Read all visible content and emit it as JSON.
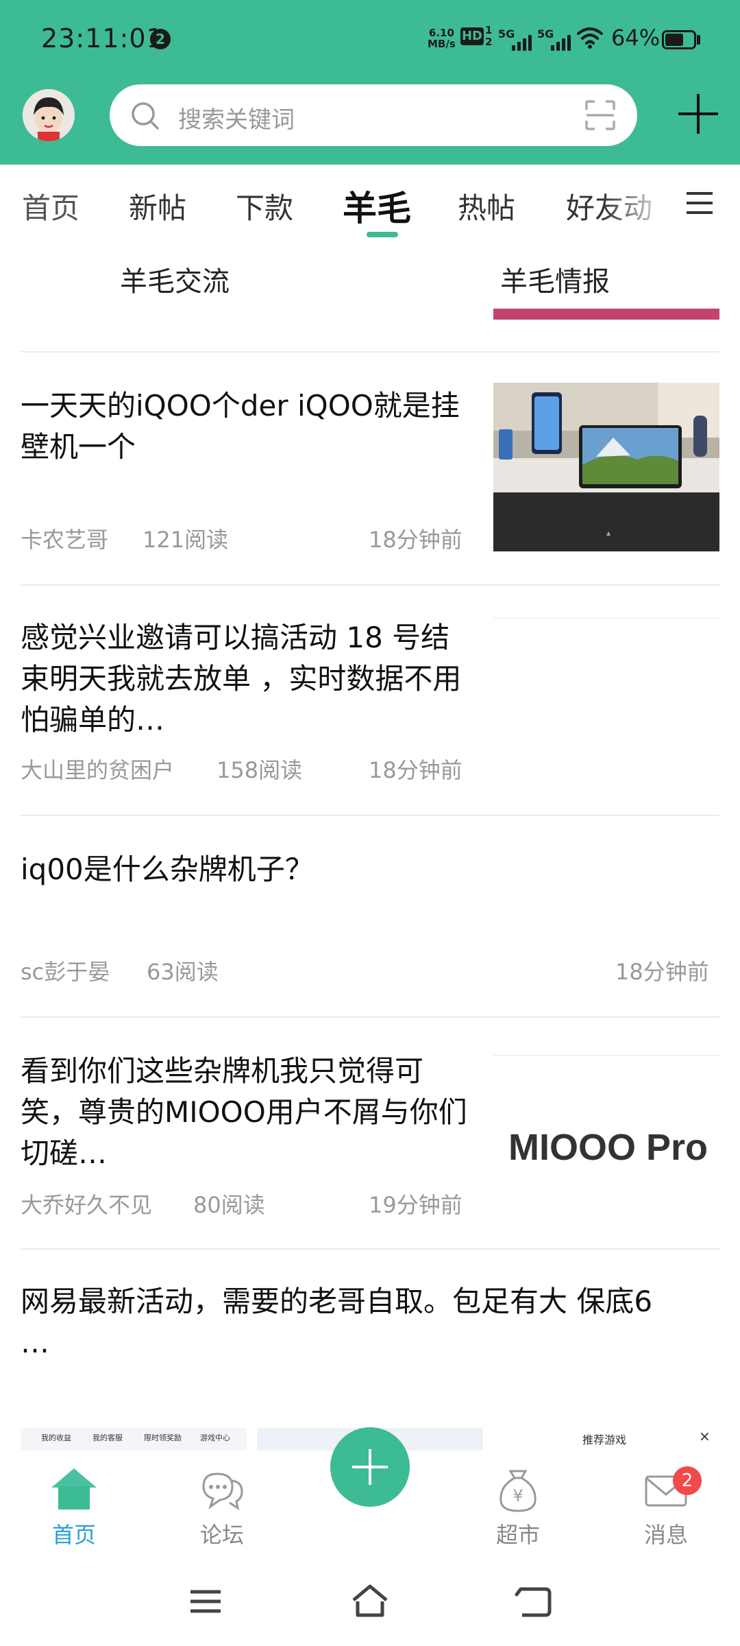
{
  "status_bar": {
    "time": "23:11:01",
    "notification_count": "2",
    "net_speed_value": "6.10",
    "net_speed_unit": "MB/s",
    "hd_label": "HD",
    "hd_sub_top": "1",
    "hd_sub_bottom": "2",
    "signal_1": "5G",
    "signal_2": "5G",
    "battery_pct": "64%",
    "battery_level": 0.64
  },
  "header": {
    "search_placeholder": "搜索关键词"
  },
  "channels": [
    {
      "label": "首页"
    },
    {
      "label": "新帖"
    },
    {
      "label": "下款"
    },
    {
      "label": "羊毛",
      "active": true
    },
    {
      "label": "热帖"
    },
    {
      "label": "好友动"
    }
  ],
  "subtabs": [
    {
      "label": "羊毛交流",
      "active": true
    },
    {
      "label": "羊毛情报"
    }
  ],
  "posts": [
    {
      "title": "一天天的iQOO个der iQOO就是挂壁机一个",
      "author": "卡农艺哥",
      "reads": "121阅读",
      "time": "18分钟前",
      "thumbnail": "photo-phone-and-tablet"
    },
    {
      "title": "感觉兴业邀请可以搞活动 18 号结束明天我就去放单 ，实时数据不用怕骗单的…",
      "author": "大山里的贫困户",
      "reads": "158阅读",
      "time": "18分钟前",
      "thumbnail": "blank"
    },
    {
      "title": "iq00是什么杂牌机子？",
      "author": "sc彭于晏",
      "reads": "63阅读",
      "time": "18分钟前"
    },
    {
      "title": "看到你们这些杂牌机我只觉得可笑，尊贵的MIOOO用户不屑与你们切磋…",
      "author": "大乔好久不见",
      "reads": "80阅读",
      "time": "19分钟前",
      "thumbnail_text": "MIOOO Pro"
    },
    {
      "title": "网易最新活动，需要的老哥自取。包足有大 保底6",
      "title_more": "…",
      "thumb_captions": [
        "我的收益",
        "我的客服",
        "限时领奖励",
        "游戏中心"
      ],
      "thumb_right_caption": "推荐游戏",
      "thumb_close": "×"
    }
  ],
  "bottom_nav": [
    {
      "label": "首页",
      "icon": "home-icon",
      "active": true
    },
    {
      "label": "论坛",
      "icon": "forum-icon"
    },
    {
      "label": "",
      "icon": "plus-icon"
    },
    {
      "label": "超市",
      "icon": "money-bag-icon"
    },
    {
      "label": "消息",
      "icon": "mail-icon",
      "badge": "2"
    }
  ],
  "colors": {
    "brand": "#3dbb95",
    "active_nav": "#2a9fd6",
    "badge": "#f04a4a",
    "indicator": "#3dbb95",
    "accent_pink": "#c2436b"
  }
}
